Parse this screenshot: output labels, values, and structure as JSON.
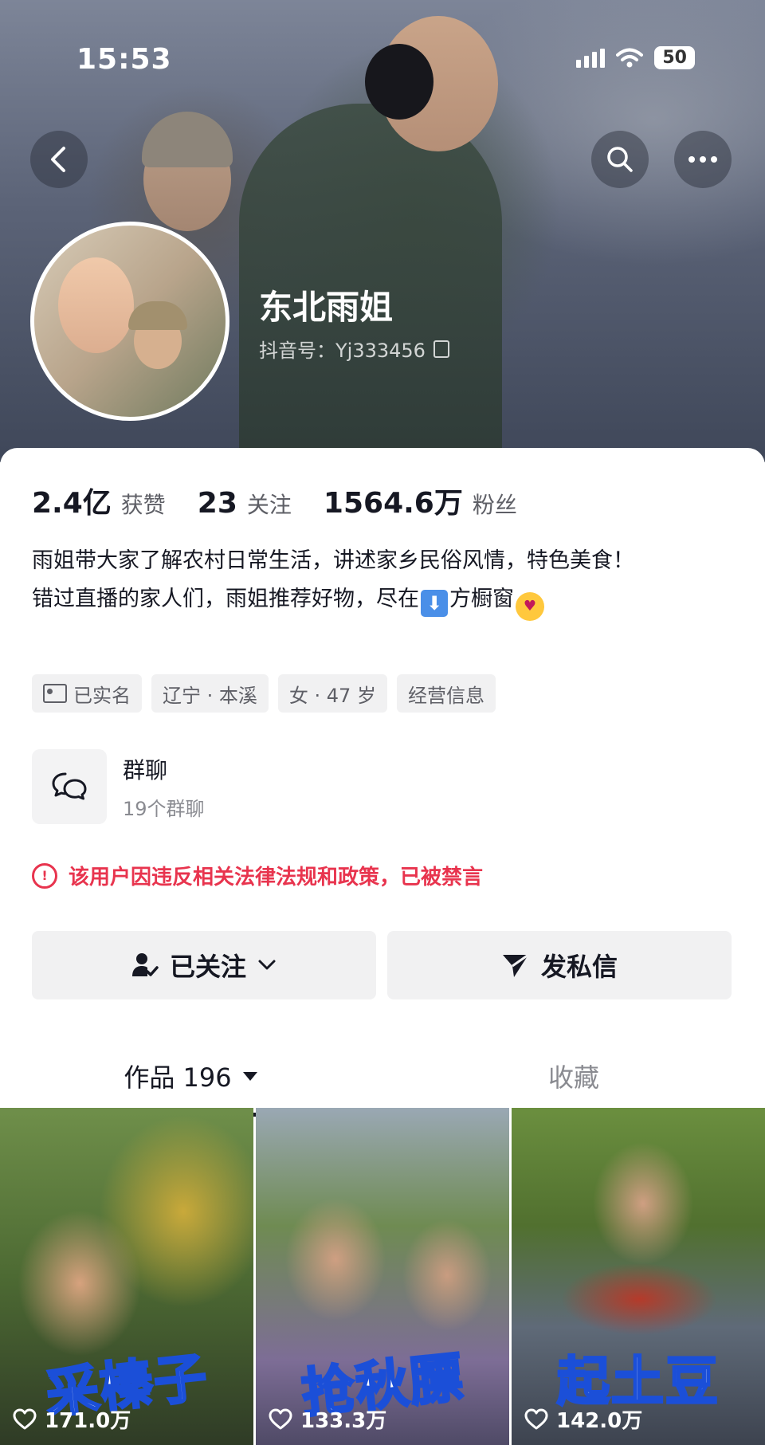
{
  "status_bar": {
    "time": "15:53",
    "battery": "50"
  },
  "profile": {
    "name": "东北雨姐",
    "douyin_id": "抖音号：Yj333456"
  },
  "stats": [
    {
      "value": "2.4亿",
      "label": "获赞"
    },
    {
      "value": "23",
      "label": "关注"
    },
    {
      "value": "1564.6万",
      "label": "粉丝"
    }
  ],
  "bio": {
    "line1": "雨姐带大家了解农村日常生活，讲述家乡民俗风情，特色美食！",
    "line2_before": "错过直播的家人们，雨姐推荐好物，尽在",
    "line2_after": "方橱窗"
  },
  "tags": [
    {
      "label": "已实名",
      "icon": "id-card-icon"
    },
    {
      "label": "辽宁 · 本溪"
    },
    {
      "label": "女 · 47 岁"
    },
    {
      "label": "经营信息"
    }
  ],
  "group_chat": {
    "title": "群聊",
    "subtitle": "19个群聊",
    "icon": "chat-bubbles-icon"
  },
  "banned_notice": "该用户因违反相关法律法规和政策，已被禁言",
  "buttons": {
    "follow": "已关注",
    "message": "发私信"
  },
  "tabs": {
    "works": "作品 196",
    "favorites": "收藏"
  },
  "videos": [
    {
      "title": "采榛子",
      "likes": "171.0万"
    },
    {
      "title": "抢秋膘",
      "likes": "133.3万"
    },
    {
      "title": "起土豆",
      "likes": "142.0万"
    }
  ]
}
